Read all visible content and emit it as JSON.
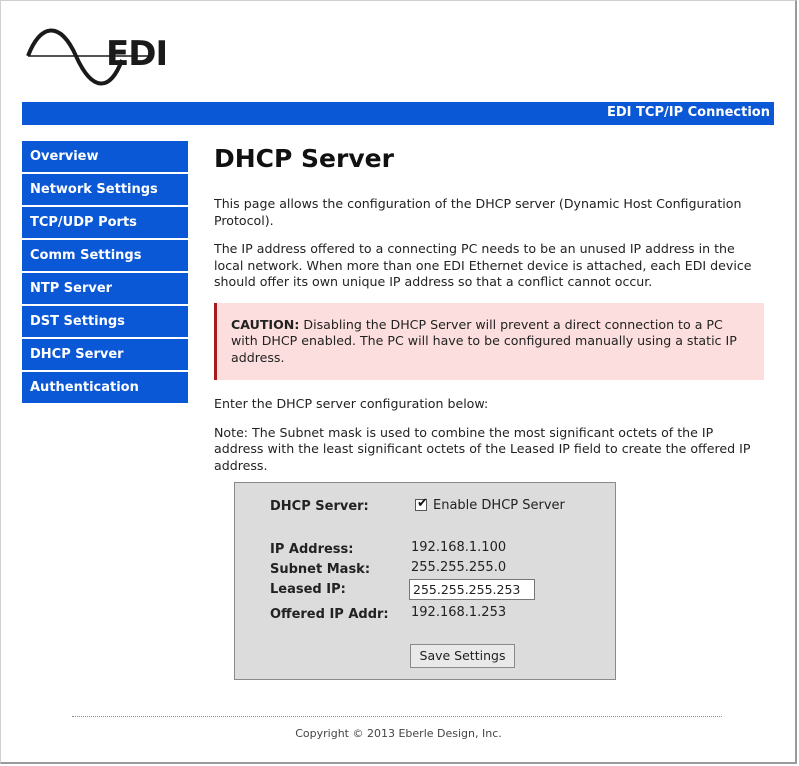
{
  "brand": {
    "logo_text": "EDI"
  },
  "header": {
    "banner_title": "EDI TCP/IP Connection"
  },
  "nav": {
    "items": [
      {
        "label": "Overview"
      },
      {
        "label": "Network Settings"
      },
      {
        "label": "TCP/UDP Ports"
      },
      {
        "label": "Comm Settings"
      },
      {
        "label": "NTP Server"
      },
      {
        "label": "DST Settings"
      },
      {
        "label": "DHCP Server"
      },
      {
        "label": "Authentication"
      }
    ]
  },
  "main": {
    "title": "DHCP Server",
    "intro": "This page allows the configuration of the DHCP server (Dynamic Host Configuration Protocol).",
    "paragraph2": "The IP address offered to a connecting PC needs to be an unused IP address in the local network. When more than one EDI Ethernet device is attached, each EDI device should offer its own unique IP address so that a conflict cannot occur.",
    "caution_label": "CAUTION:",
    "caution_text": " Disabling the DHCP Server will prevent a direct connection to a PC with DHCP enabled. The PC will have to be configured manually using a static IP address.",
    "enter_text": "Enter the DHCP server configuration below:",
    "note_text": "Note: The Subnet mask is used to combine the most significant octets of the IP address with the least significant octets of the Leased IP field to create the offered IP address."
  },
  "form": {
    "dhcp_server_label": "DHCP Server:",
    "enable_label": "Enable DHCP Server",
    "enable_checked": true,
    "ip_address_label": "IP Address:",
    "ip_address_value": "192.168.1.100",
    "subnet_mask_label": "Subnet Mask:",
    "subnet_mask_value": "255.255.255.0",
    "leased_ip_label": "Leased IP:",
    "leased_ip_value": "255.255.255.253",
    "offered_ip_label": "Offered IP Addr:",
    "offered_ip_value": "192.168.1.253",
    "save_label": "Save Settings"
  },
  "footer": {
    "copyright": "Copyright © 2013 Eberle Design, Inc."
  },
  "colors": {
    "accent": "#0a58d6",
    "caution_bg": "#fcdede",
    "caution_border": "#a61c1c",
    "form_bg": "#dcdcdc"
  }
}
